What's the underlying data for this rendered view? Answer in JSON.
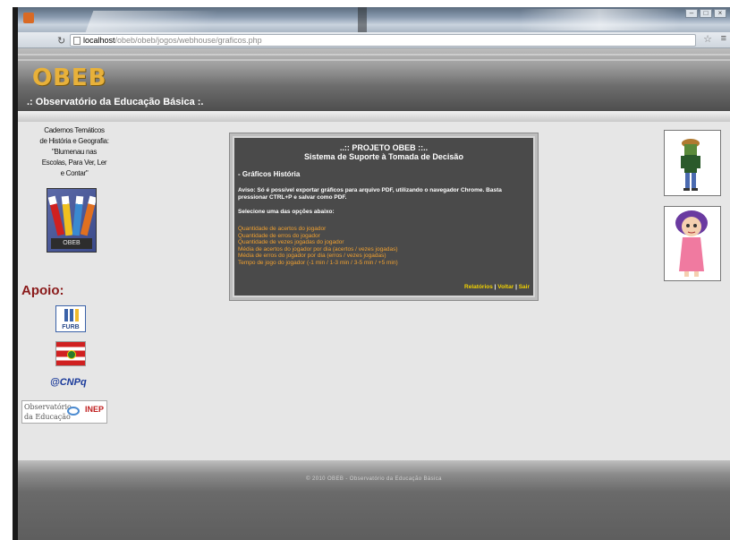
{
  "browser": {
    "url_host": "localhost",
    "url_path": "/obeb/obeb/jogos/webhouse/graficos.php"
  },
  "site": {
    "logo": "OBEB",
    "tagline": ".: Observatório da Educação Básica :."
  },
  "left": {
    "caderno_lines": [
      "Cadernos Temáticos",
      "de História e Geografia:",
      "\"Blumenau nas",
      "Escolas, Para Ver, Ler",
      "e Contar\""
    ],
    "caderno_book_label": "OBEB",
    "apoio_title": "Apoio:",
    "furb_label": "FURB",
    "cnpq_label": "CNPq",
    "obs_lines": [
      "Observatório",
      "da Educação"
    ],
    "inep_label": "INEP"
  },
  "panel": {
    "title_line1": "..:: PROJETO OBEB ::..",
    "title_line2": "Sistema de Suporte à Tomada de Decisão",
    "section_title": "- Gráficos História",
    "notice": "Aviso: Só é possível exportar gráficos para arquivo PDF, utilizando o navegador Chrome. Basta pressionar CTRL+P e salvar como PDF.",
    "instruction": "Selecione uma das opções abaixo:",
    "options": [
      "Quantidade de acertos do jogador",
      "Quantidade de erros do jogador",
      "Quantidade de vezes jogadas do jogador",
      "Média de acertos do jogador por dia (acertos / vezes jogadas)",
      "Média de erros do jogador por dia (erros / vezes jogadas)",
      "Tempo de jogo do jogador (-1 min / 1-3 min / 3-5 min / +5 min)"
    ],
    "links": {
      "relatorios": "Relatórios",
      "voltar": "Voltar",
      "sair": "Sair",
      "separator": "|"
    }
  },
  "footer": {
    "copyright": "© 2010 OBEB - Observatório da Educação Básica"
  },
  "colors": {
    "logo": "#e8b13a",
    "option_link": "#f0a030",
    "footer_link": "#f0d000",
    "apoio": "#8a1a1a",
    "panel_bg": "#4a4a4a"
  }
}
